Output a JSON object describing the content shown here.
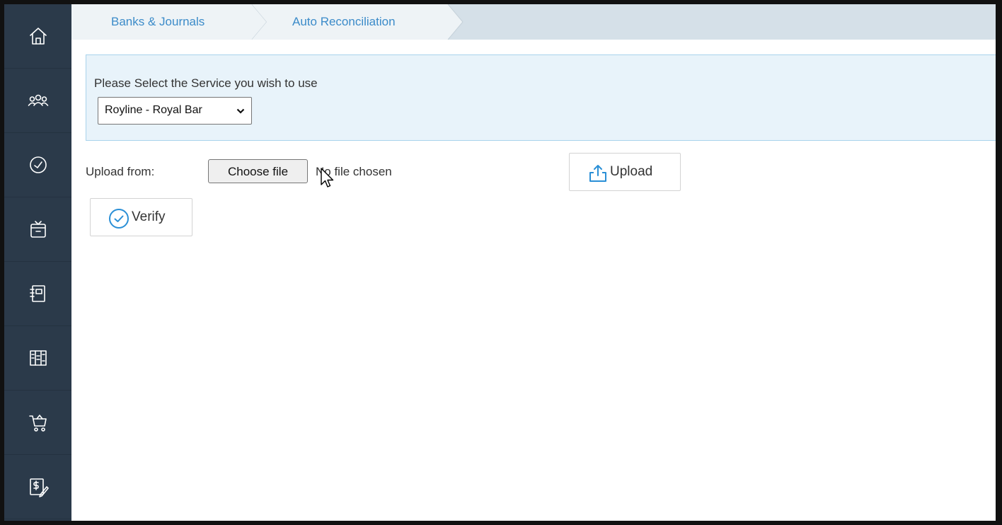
{
  "sidebar": {
    "items": [
      {
        "icon": "home-icon"
      },
      {
        "icon": "contacts-icon"
      },
      {
        "icon": "dashboard-icon"
      },
      {
        "icon": "inbox-icon"
      },
      {
        "icon": "ledger-icon"
      },
      {
        "icon": "reports-icon"
      },
      {
        "icon": "cart-icon"
      },
      {
        "icon": "invoice-icon"
      }
    ]
  },
  "breadcrumb": {
    "items": [
      "Banks & Journals",
      "Auto Reconciliation"
    ]
  },
  "service": {
    "label": "Please Select the Service you wish to use",
    "selected": "Royline - Royal Bar"
  },
  "upload": {
    "label": "Upload from:",
    "choose_button": "Choose file",
    "file_status": "No file chosen",
    "upload_button": "Upload"
  },
  "verify": {
    "button": "Verify"
  },
  "colors": {
    "sidebar": "#2b3a4a",
    "breadcrumb_bar": "#d5e0e8",
    "link": "#3b8bc9",
    "panel_bg": "#e8f3fa",
    "panel_border": "#a9d3ec",
    "accent_icon": "#2a8fd6"
  }
}
